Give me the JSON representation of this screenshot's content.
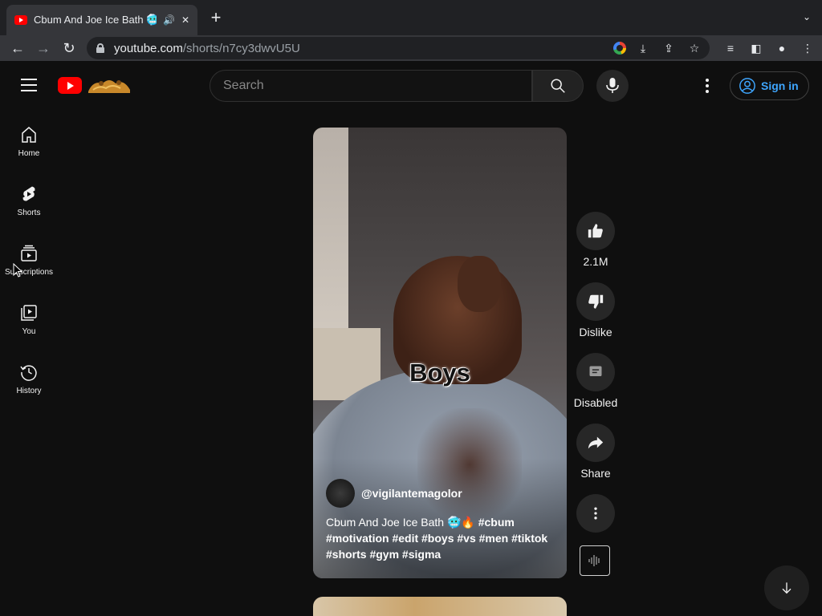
{
  "browser": {
    "tab_title": "Cbum And Joe Ice Bath 🥶 |",
    "url_host": "youtube.com",
    "url_path": "/shorts/n7cy3dwvU5U"
  },
  "header": {
    "search_placeholder": "Search",
    "sign_in_label": "Sign in"
  },
  "sidebar": {
    "items": [
      {
        "label": "Home",
        "icon": "home-icon"
      },
      {
        "label": "Shorts",
        "icon": "shorts-icon"
      },
      {
        "label": "Subscriptions",
        "icon": "subscriptions-icon"
      },
      {
        "label": "You",
        "icon": "you-icon"
      },
      {
        "label": "History",
        "icon": "history-icon"
      }
    ]
  },
  "short": {
    "overlay_text": "Boys",
    "channel": "@vigilantemagolor",
    "caption_title": "Cbum And Joe Ice Bath 🥶🔥",
    "caption_tags": "#cbum #motivation #edit #boys #vs #men #tiktok #shorts #gym #sigma"
  },
  "actions": {
    "like_count": "2.1M",
    "dislike_label": "Dislike",
    "comments_label": "Disabled",
    "share_label": "Share"
  },
  "colors": {
    "background": "#0f0f0f",
    "brand_red": "#ff0000",
    "link_blue": "#3ea6ff",
    "button_bg": "#272727"
  }
}
